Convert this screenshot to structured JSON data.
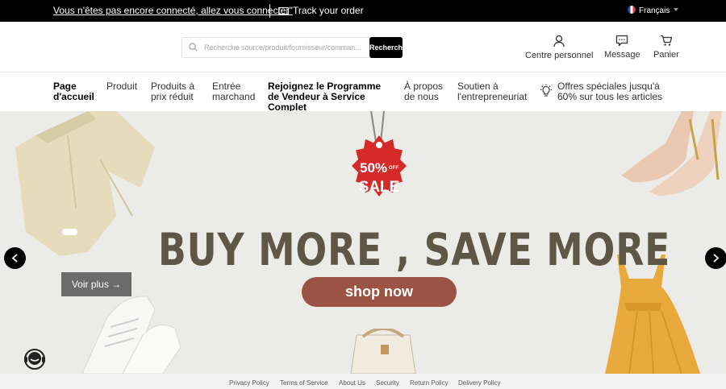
{
  "topbar": {
    "login_text": "Vous n'êtes pas encore connecté, allez vous connecter\"",
    "track_label": "Track your order",
    "language": "Français"
  },
  "header": {
    "search": {
      "placeholder": "Recherche source/produit/fournisseur/comman...",
      "button_label": "Recherch"
    },
    "icons": [
      {
        "label": "Centre personnel",
        "icon": "user-icon"
      },
      {
        "label": "Message",
        "icon": "message-icon"
      },
      {
        "label": "Panier",
        "icon": "cart-icon"
      }
    ]
  },
  "nav": {
    "items": [
      {
        "label": "Page d'accueil",
        "active": true
      },
      {
        "label": "Produit"
      },
      {
        "label": "Produits à prix réduit"
      },
      {
        "label": "Entrée marchand"
      },
      {
        "label": "Rejoignez le Programme de Vendeur à Service Complet",
        "bold": true
      },
      {
        "label": "À propos de nous"
      },
      {
        "label": "Soutien à l'entrepreneuriat"
      }
    ],
    "offer": "Offres spéciales jusqu'à 60% sur tous les articles"
  },
  "banner": {
    "sale_tag": {
      "percent": "50%",
      "off": "OFF",
      "word": "SALE"
    },
    "headline": "BUY MORE , SAVE MORE",
    "cta": "shop now",
    "voir_plus": "Voir plus →"
  },
  "footer": {
    "links": [
      "Privacy Policy",
      "Terms of Service",
      "About Us",
      "Security",
      "Return Policy",
      "Delivery Policy"
    ]
  },
  "colors": {
    "topbar_bg": "#000000",
    "banner_bg": "#ebebe8",
    "headline": "#5f5745",
    "cta_bg": "#9b5443",
    "sale_red": "#d42a2a"
  }
}
